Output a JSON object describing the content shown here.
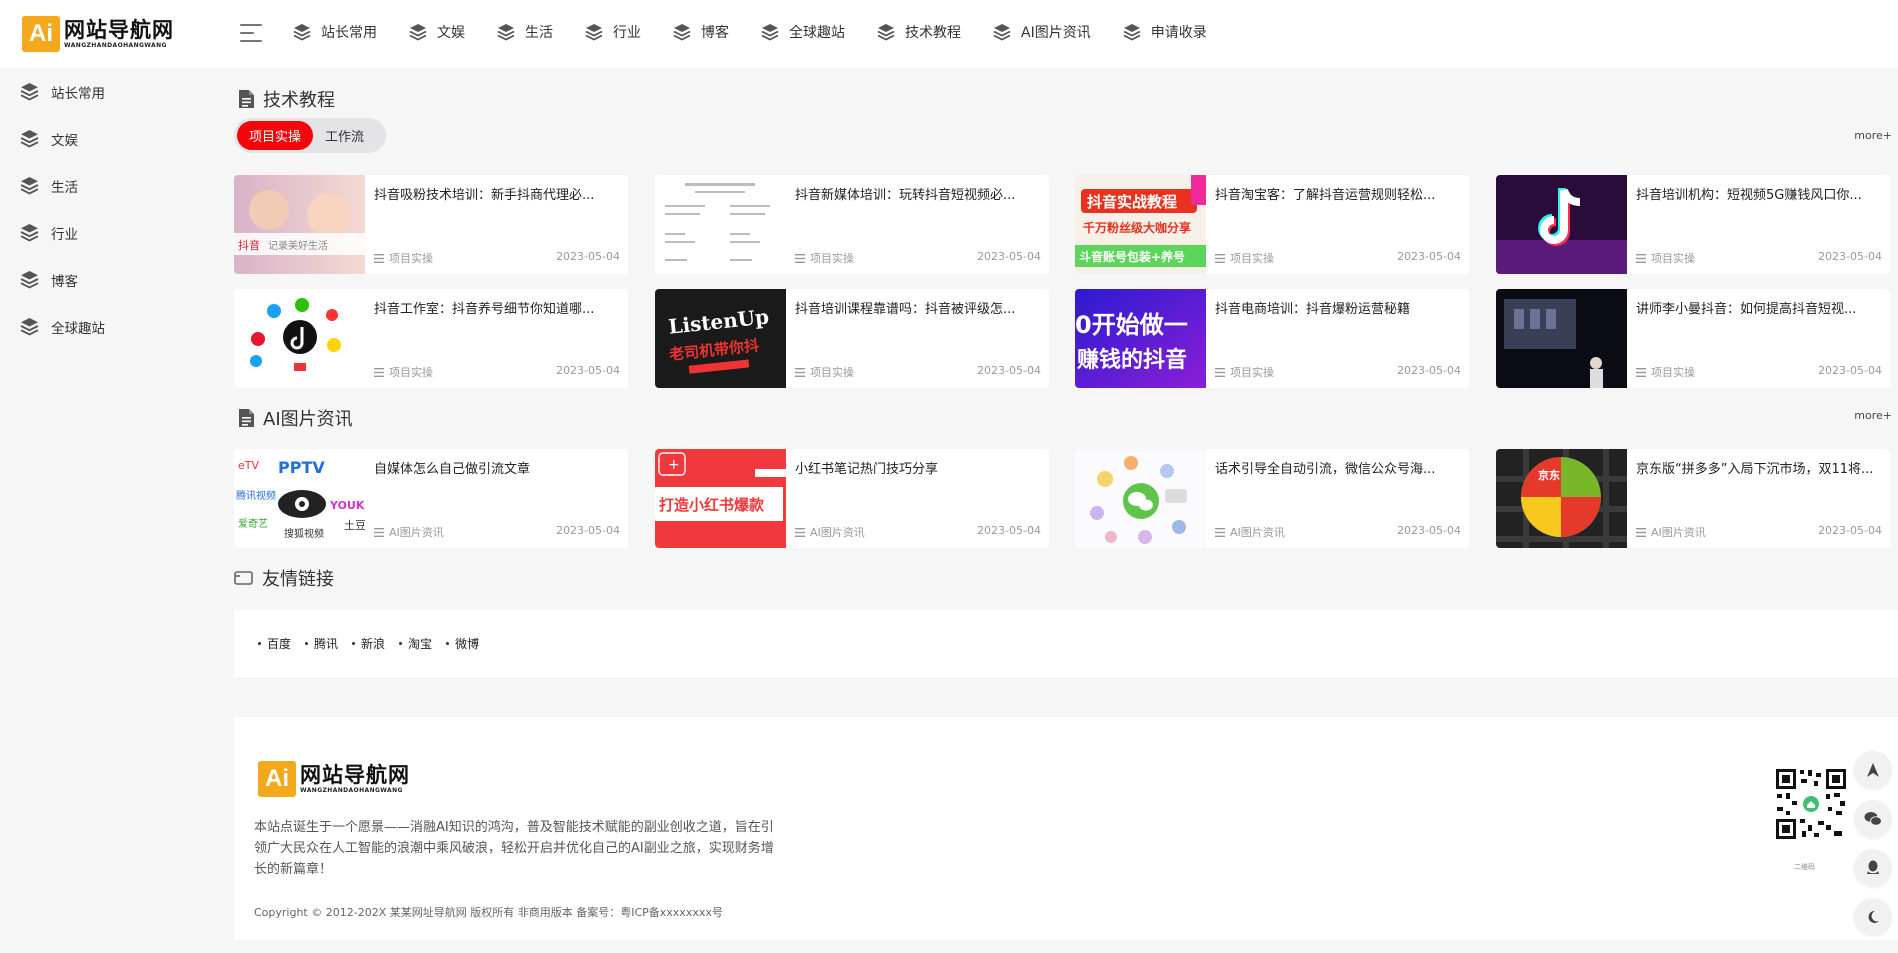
{
  "brand": {
    "logo_badge": "Ai",
    "title": "网站导航网",
    "subtitle": "WANGZHANDAOHANGWANG"
  },
  "topnav": [
    {
      "label": "站长常用"
    },
    {
      "label": "文娱"
    },
    {
      "label": "生活"
    },
    {
      "label": "行业"
    },
    {
      "label": "博客"
    },
    {
      "label": "全球趣站"
    },
    {
      "label": "技术教程"
    },
    {
      "label": "AI图片资讯"
    },
    {
      "label": "申请收录"
    }
  ],
  "sidebar": [
    {
      "label": "站长常用"
    },
    {
      "label": "文娱"
    },
    {
      "label": "生活"
    },
    {
      "label": "行业"
    },
    {
      "label": "博客"
    },
    {
      "label": "全球趣站"
    }
  ],
  "section_tech": {
    "title": "技术教程",
    "more": "more+",
    "tabs": [
      {
        "label": "项目实操",
        "active": true
      },
      {
        "label": "工作流",
        "active": false
      }
    ],
    "cards": [
      {
        "title": "抖音吸粉技术培训：新手抖商代理必...",
        "category": "项目实操",
        "date": "2023-05-04",
        "thumb_text": "抖音"
      },
      {
        "title": "抖音新媒体培训：玩转抖音短视频必...",
        "category": "项目实操",
        "date": "2023-05-04",
        "thumb_text": "文档"
      },
      {
        "title": "抖音淘宝客：了解抖音运营规则轻松...",
        "category": "项目实操",
        "date": "2023-05-04",
        "thumb_text": "抖音实战教程"
      },
      {
        "title": "抖音培训机构：短视频5G赚钱风口你...",
        "category": "项目实操",
        "date": "2023-05-04",
        "thumb_text": ""
      },
      {
        "title": "抖音工作室：抖音养号细节你知道哪...",
        "category": "项目实操",
        "date": "2023-05-04",
        "thumb_text": ""
      },
      {
        "title": "抖音培训课程靠谱吗：抖音被评级怎...",
        "category": "项目实操",
        "date": "2023-05-04",
        "thumb_text": "ListenUp"
      },
      {
        "title": "抖音电商培训：抖音爆粉运营秘籍",
        "category": "项目实操",
        "date": "2023-05-04",
        "thumb_text": "0开始做一"
      },
      {
        "title": "讲师李小曼抖音：如何提高抖音短视...",
        "category": "项目实操",
        "date": "2023-05-04",
        "thumb_text": ""
      }
    ]
  },
  "section_ai": {
    "title": "AI图片资讯",
    "more": "more+",
    "cards": [
      {
        "title": "自媒体怎么自己做引流文章",
        "category": "AI图片资讯",
        "date": "2023-05-04",
        "thumb_text": "PPTV"
      },
      {
        "title": "小红书笔记热门技巧分享",
        "category": "AI图片资讯",
        "date": "2023-05-04",
        "thumb_text": "打造小红书爆款"
      },
      {
        "title": "话术引导全自动引流，微信公众号海...",
        "category": "AI图片资讯",
        "date": "2023-05-04",
        "thumb_text": ""
      },
      {
        "title": "京东版“拼多多”入局下沉市场，双11将...",
        "category": "AI图片资讯",
        "date": "2023-05-04",
        "thumb_text": "京东"
      }
    ]
  },
  "friend_links": {
    "title": "友情链接",
    "links": [
      {
        "label": "百度"
      },
      {
        "label": "腾讯"
      },
      {
        "label": "新浪"
      },
      {
        "label": "淘宝"
      },
      {
        "label": "微博"
      }
    ]
  },
  "footer": {
    "description": "本站点诞生于一个愿景——消融AI知识的鸿沟，普及智能技术赋能的副业创收之道，旨在引领广大民众在人工智能的浪潮中乘风破浪，轻松开启并优化自己的AI副业之旅，实现财务增长的新篇章！",
    "copyright": "Copyright © 2012-202X 某某网址导航网 版权所有 非商用版本 备案号：粤ICP备xxxxxxxx号",
    "qr_caption": "二维码"
  },
  "colors": {
    "accent_red": "#f1060b",
    "logo_orange": "#f4a91c"
  }
}
